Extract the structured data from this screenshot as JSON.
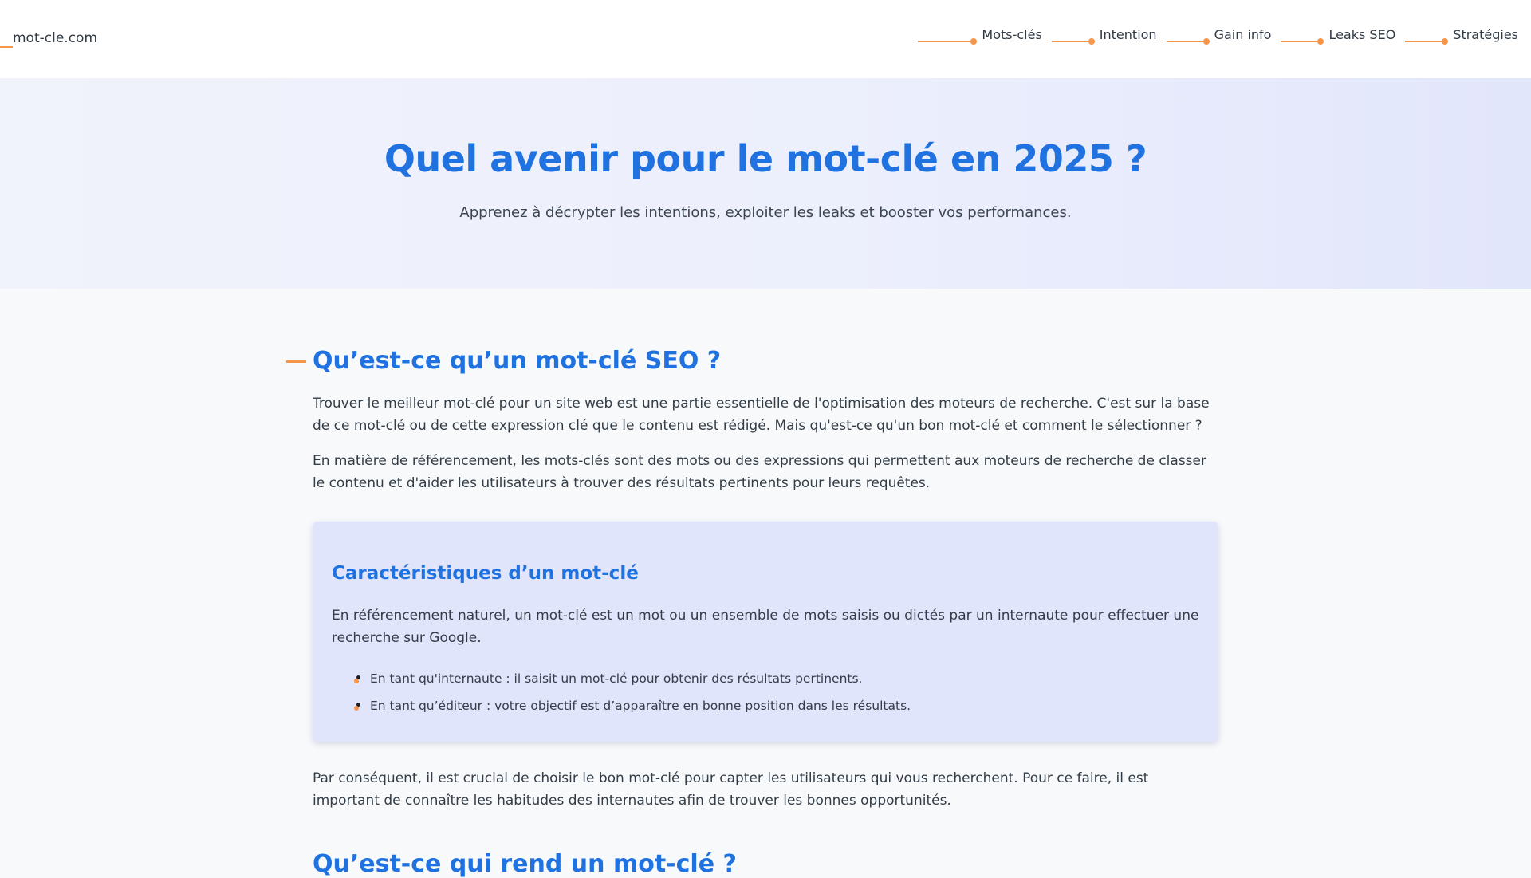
{
  "header": {
    "brand": "mot-cle.com",
    "nav": [
      {
        "label": "Mots-clés"
      },
      {
        "label": "Intention"
      },
      {
        "label": "Gain info"
      },
      {
        "label": "Leaks SEO"
      },
      {
        "label": "Stratégies"
      }
    ]
  },
  "hero": {
    "title": "Quel avenir pour le mot-clé en 2025 ?",
    "subtitle": "Apprenez à décrypter les intentions, exploiter les leaks et booster vos performances."
  },
  "section1": {
    "title": "Qu’est-ce qu’un mot-clé SEO ?",
    "p1": "Trouver le meilleur mot-clé pour un site web est une partie essentielle de l'optimisation des moteurs de recherche. C'est sur la base de ce mot-clé ou de cette expression clé que le contenu est rédigé. Mais qu'est-ce qu'un bon mot-clé et comment le sélectionner ?",
    "p2": "En matière de référencement, les mots-clés sont des mots ou des expressions qui permettent aux moteurs de recherche de classer le contenu et d'aider les utilisateurs à trouver des résultats pertinents pour leurs requêtes.",
    "card": {
      "title": "Caractéristiques d’un mot-clé",
      "text": "En référencement naturel, un mot-clé est un mot ou un ensemble de mots saisis ou dictés par un internaute pour effectuer une recherche sur Google.",
      "items": [
        "En tant qu'internaute : il saisit un mot-clé pour obtenir des résultats pertinents.",
        "En tant qu’éditeur : votre objectif est d’apparaître en bonne position dans les résultats."
      ]
    },
    "p3": "Par conséquent, il est crucial de choisir le bon mot-clé pour capter les utilisateurs qui vous recherchent. Pour ce faire, il est important de connaître les habitudes des internautes afin de trouver les bonnes opportunités."
  },
  "section2": {
    "title": "Qu’est-ce qui rend un mot-clé ?"
  },
  "colors": {
    "accent": "#1f72e0",
    "orange": "#f5964b",
    "card_bg": "#e0e5fc"
  }
}
